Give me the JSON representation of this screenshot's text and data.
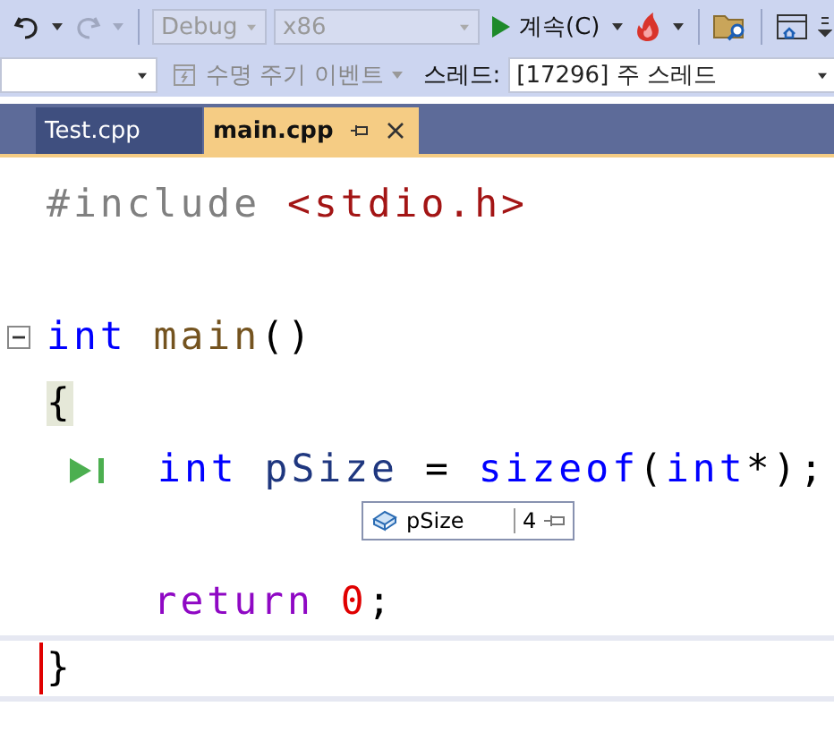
{
  "toolbar": {
    "redo_disabled": true,
    "configuration": {
      "value": "Debug",
      "disabled": true
    },
    "platform": {
      "value": "x86",
      "disabled": true
    },
    "continue_button": "계속(C)"
  },
  "debug_location": {
    "lifecycle_events": {
      "label": "수명 주기 이벤트",
      "disabled": true
    },
    "thread_label": "스레드:",
    "thread": {
      "value": "[17296] 주 스레드"
    }
  },
  "tabs": [
    {
      "label": "Test.cpp",
      "selected": false
    },
    {
      "label": "main.cpp",
      "selected": true
    }
  ],
  "code_lines": [
    {
      "tokens": [
        {
          "text": "#include ",
          "kind": "preprocessor"
        },
        {
          "text": "<stdio.h>",
          "kind": "string"
        }
      ]
    },
    {
      "blank_line_before": true,
      "expanded": true,
      "tokens": [
        {
          "text": "int ",
          "kind": "keyword"
        },
        {
          "text": "main",
          "kind": "function"
        },
        {
          "text": "()",
          "kind": "plain"
        }
      ]
    },
    {
      "brace_match": true,
      "tokens": [
        {
          "text": "{",
          "kind": "plain"
        }
      ]
    },
    {
      "current": true,
      "tokens": [
        {
          "text": "int ",
          "kind": "keyword"
        },
        {
          "text": "pSize ",
          "kind": "variable"
        },
        {
          "text": "= ",
          "kind": "plain"
        },
        {
          "text": "sizeof",
          "kind": "keyword"
        },
        {
          "text": "(",
          "kind": "plain"
        },
        {
          "text": "int",
          "kind": "keyword"
        },
        {
          "text": "*);",
          "kind": "plain"
        }
      ]
    },
    {
      "blank_line_before": true,
      "tokens": [
        {
          "text": "    return ",
          "kind": "control"
        },
        {
          "text": "0",
          "kind": "number"
        },
        {
          "text": ";",
          "kind": "plain"
        }
      ]
    },
    {
      "highlighted": true,
      "caret": true,
      "tokens": [
        {
          "text": "}",
          "kind": "plain"
        }
      ]
    }
  ],
  "datatip": {
    "name": "pSize",
    "value": "4"
  }
}
